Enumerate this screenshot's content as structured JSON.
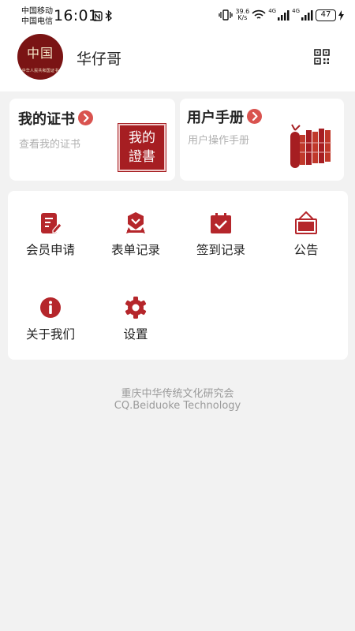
{
  "status_bar": {
    "carrier_1": "中国移动",
    "carrier_2": "中国电信",
    "time": "16:01",
    "speed_value": "39.6",
    "speed_unit": "K/s",
    "network_1": "4G",
    "network_2": "4G",
    "battery": "47"
  },
  "profile": {
    "avatar_text": "中国",
    "avatar_subtext": "中华人民共和国证书",
    "username": "华仔哥",
    "qr_icon": "qr-code-icon"
  },
  "cards": {
    "certificate": {
      "title": "我的证书",
      "subtitle": "查看我的证书",
      "art_text_1": "我的",
      "art_text_2": "證書"
    },
    "manual": {
      "title": "用户手册",
      "subtitle": "用户操作手册"
    }
  },
  "menu": [
    {
      "label": "会员申请",
      "icon": "edit-form-icon"
    },
    {
      "label": "表单记录",
      "icon": "badge-icon"
    },
    {
      "label": "签到记录",
      "icon": "calendar-check-icon"
    },
    {
      "label": "公告",
      "icon": "announcement-board-icon"
    },
    {
      "label": "关于我们",
      "icon": "info-icon"
    },
    {
      "label": "设置",
      "icon": "gear-icon"
    }
  ],
  "footer": {
    "line1": "重庆中华传统文化研究会",
    "line2": "CQ.Beiduoke Technology"
  },
  "colors": {
    "accent": "#b5262b",
    "chevron": "#d9534f",
    "background": "#f2f2f2"
  }
}
